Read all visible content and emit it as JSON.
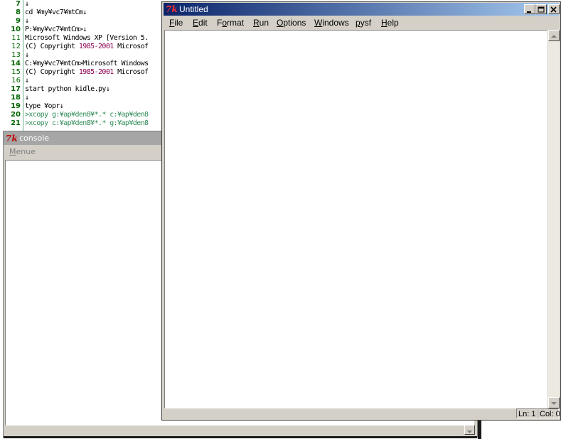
{
  "background_editor": {
    "lines": [
      {
        "num": "7",
        "text": "↓",
        "bold": true
      },
      {
        "num": "8",
        "text": "cd ¥my¥vc7¥mtCm↓",
        "bold": true
      },
      {
        "num": "9",
        "text": "↓",
        "bold": true
      },
      {
        "num": "10",
        "text": "P:¥my¥vc7¥mtCm>↓",
        "bold": true
      },
      {
        "num": "11",
        "text_a": "Microsoft Windows XP [Version 5.",
        "bold": false
      },
      {
        "num": "12",
        "text_a": "(C) Copyright ",
        "text_hl": "1985-2001",
        "text_b": " Microsof",
        "bold": false
      },
      {
        "num": "13",
        "text": "↓",
        "bold": false
      },
      {
        "num": "14",
        "text": "C:¥my¥vc7¥mtCm>Microsoft Windows",
        "bold": true
      },
      {
        "num": "15",
        "text_a": "(C) Copyright ",
        "text_hl": "1985-2001",
        "text_b": " Microsof",
        "bold": false
      },
      {
        "num": "16",
        "text": "↓",
        "bold": false
      },
      {
        "num": "17",
        "text": "start python kidle.py↓",
        "bold": true
      },
      {
        "num": "18",
        "text": "↓",
        "bold": true
      },
      {
        "num": "19",
        "text": "type ¥opr↓",
        "bold": true
      },
      {
        "num": "20",
        "text_cmd": ">xcopy g:¥ap¥den8¥*.* c:¥ap¥den8",
        "bold": true
      },
      {
        "num": "21",
        "text_cmd": ">xcopy c:¥ap¥den8¥*.* g:¥ap¥den8",
        "bold": true
      }
    ]
  },
  "console_window": {
    "title": "console",
    "menu": {
      "label_first": "M",
      "label_rest": "enue"
    }
  },
  "untitled_window": {
    "title": "Untitled",
    "menu": [
      {
        "ul": "F",
        "rest": "ile"
      },
      {
        "ul": "E",
        "rest": "dit"
      },
      {
        "pre": "F",
        "ul": "o",
        "rest": "rmat"
      },
      {
        "ul": "R",
        "rest": "un"
      },
      {
        "ul": "O",
        "rest": "ptions"
      },
      {
        "ul": "W",
        "rest": "indows"
      },
      {
        "ul": "p",
        "rest": "ysf"
      },
      {
        "ul": "H",
        "rest": "elp"
      }
    ],
    "status": {
      "line": "Ln: 1",
      "col": "Col: 0"
    }
  },
  "colors": {
    "title_active_start": "#0a246a",
    "title_active_end": "#a6caf0",
    "title_inactive": "#a6a6a6",
    "line_number": "#006400"
  }
}
